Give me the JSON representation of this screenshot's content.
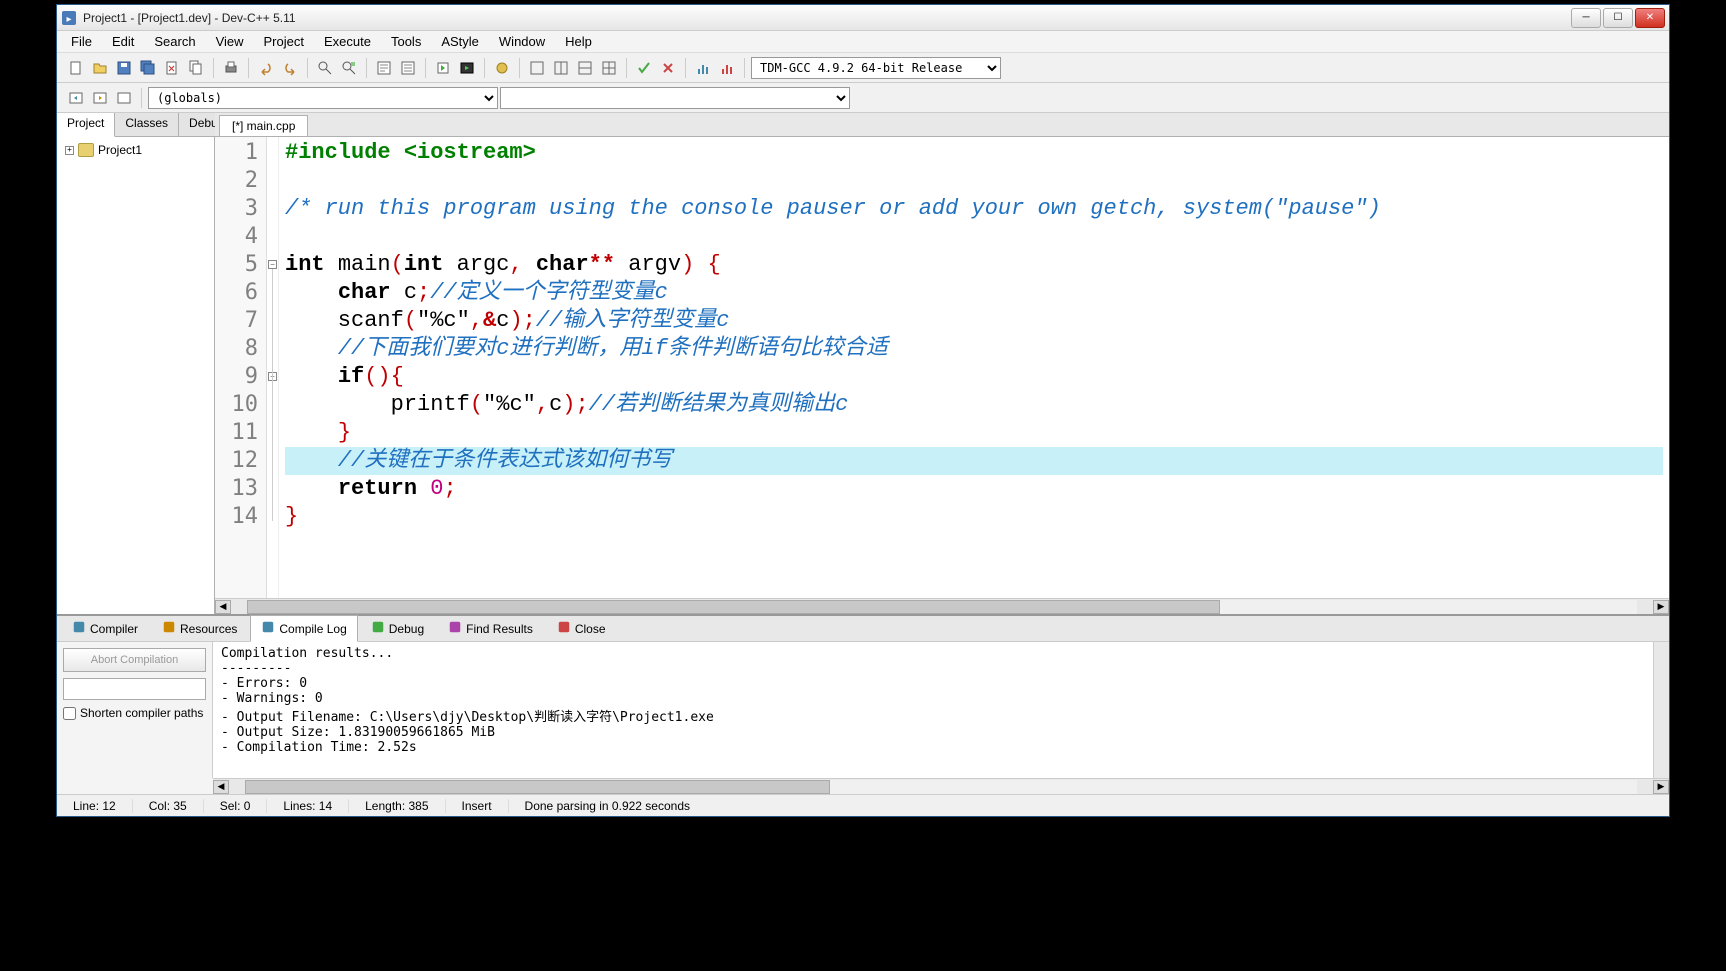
{
  "window": {
    "title": "Project1 - [Project1.dev] - Dev-C++ 5.11"
  },
  "menu": [
    "File",
    "Edit",
    "Search",
    "View",
    "Project",
    "Execute",
    "Tools",
    "AStyle",
    "Window",
    "Help"
  ],
  "compiler_profile": "TDM-GCC 4.9.2 64-bit Release",
  "scope_selector": "(globals)",
  "left_tabs": [
    "Project",
    "Classes",
    "Debug"
  ],
  "left_active": "Project",
  "project_tree": {
    "root": "Project1"
  },
  "editor_tab": "[*] main.cpp",
  "code": {
    "lines": [
      {
        "n": 1,
        "seg": [
          {
            "c": "tok-pre",
            "t": "#include <iostream>"
          }
        ]
      },
      {
        "n": 2,
        "seg": []
      },
      {
        "n": 3,
        "seg": [
          {
            "c": "tok-comment",
            "t": "/* run this program using the console pauser or add your own getch, system(\"pause\")"
          }
        ]
      },
      {
        "n": 4,
        "seg": []
      },
      {
        "n": 5,
        "seg": [
          {
            "c": "tok-kw",
            "t": "int"
          },
          {
            "t": " "
          },
          {
            "c": "tok-name",
            "t": "main"
          },
          {
            "c": "tok-paren",
            "t": "("
          },
          {
            "c": "tok-kw",
            "t": "int"
          },
          {
            "t": " argc"
          },
          {
            "c": "tok-paren",
            "t": ","
          },
          {
            "t": " "
          },
          {
            "c": "tok-kw",
            "t": "char"
          },
          {
            "c": "tok-op",
            "t": "**"
          },
          {
            "t": " argv"
          },
          {
            "c": "tok-paren",
            "t": ")"
          },
          {
            "t": " "
          },
          {
            "c": "tok-paren",
            "t": "{"
          }
        ]
      },
      {
        "n": 6,
        "seg": [
          {
            "t": "    "
          },
          {
            "c": "tok-kw",
            "t": "char"
          },
          {
            "t": " c"
          },
          {
            "c": "tok-paren",
            "t": ";"
          },
          {
            "c": "tok-comment",
            "t": "//定义一个字符型变量c"
          }
        ]
      },
      {
        "n": 7,
        "seg": [
          {
            "t": "    scanf"
          },
          {
            "c": "tok-paren",
            "t": "("
          },
          {
            "c": "tok-str",
            "t": "\"%c\""
          },
          {
            "c": "tok-paren",
            "t": ","
          },
          {
            "c": "tok-op",
            "t": "&"
          },
          {
            "t": "c"
          },
          {
            "c": "tok-paren",
            "t": ");"
          },
          {
            "c": "tok-comment",
            "t": "//输入字符型变量c"
          }
        ]
      },
      {
        "n": 8,
        "seg": [
          {
            "t": "    "
          },
          {
            "c": "tok-comment",
            "t": "//下面我们要对c进行判断，用if条件判断语句比较合适"
          }
        ]
      },
      {
        "n": 9,
        "seg": [
          {
            "t": "    "
          },
          {
            "c": "tok-kw",
            "t": "if"
          },
          {
            "c": "tok-paren",
            "t": "(){"
          }
        ]
      },
      {
        "n": 10,
        "seg": [
          {
            "t": "        printf"
          },
          {
            "c": "tok-paren",
            "t": "("
          },
          {
            "c": "tok-str",
            "t": "\"%c\""
          },
          {
            "c": "tok-paren",
            "t": ","
          },
          {
            "t": "c"
          },
          {
            "c": "tok-paren",
            "t": ");"
          },
          {
            "c": "tok-comment",
            "t": "//若判断结果为真则输出c"
          }
        ]
      },
      {
        "n": 11,
        "seg": [
          {
            "t": "    "
          },
          {
            "c": "tok-paren",
            "t": "}"
          }
        ]
      },
      {
        "n": 12,
        "hl": true,
        "seg": [
          {
            "t": "    "
          },
          {
            "c": "tok-comment",
            "t": "//关键在于条件表达式该如何书写"
          }
        ]
      },
      {
        "n": 13,
        "seg": [
          {
            "t": "    "
          },
          {
            "c": "tok-kw",
            "t": "return"
          },
          {
            "t": " "
          },
          {
            "c": "tok-num",
            "t": "0"
          },
          {
            "c": "tok-paren",
            "t": ";"
          }
        ]
      },
      {
        "n": 14,
        "seg": [
          {
            "c": "tok-paren",
            "t": "}"
          }
        ]
      }
    ]
  },
  "bottom_tabs": [
    "Compiler",
    "Resources",
    "Compile Log",
    "Debug",
    "Find Results",
    "Close"
  ],
  "bottom_active": "Compile Log",
  "abort_label": "Abort Compilation",
  "shorten_label": "Shorten compiler paths",
  "compile_output": "Compilation results...\n---------\n- Errors: 0\n- Warnings: 0\n- Output Filename: C:\\Users\\djy\\Desktop\\判断读入字符\\Project1.exe\n- Output Size: 1.83190059661865 MiB\n- Compilation Time: 2.52s",
  "status": {
    "line": "Line:   12",
    "col": "Col:   35",
    "sel": "Sel:   0",
    "lines": "Lines:   14",
    "length": "Length:   385",
    "mode": "Insert",
    "msg": "Done parsing in 0.922 seconds"
  }
}
